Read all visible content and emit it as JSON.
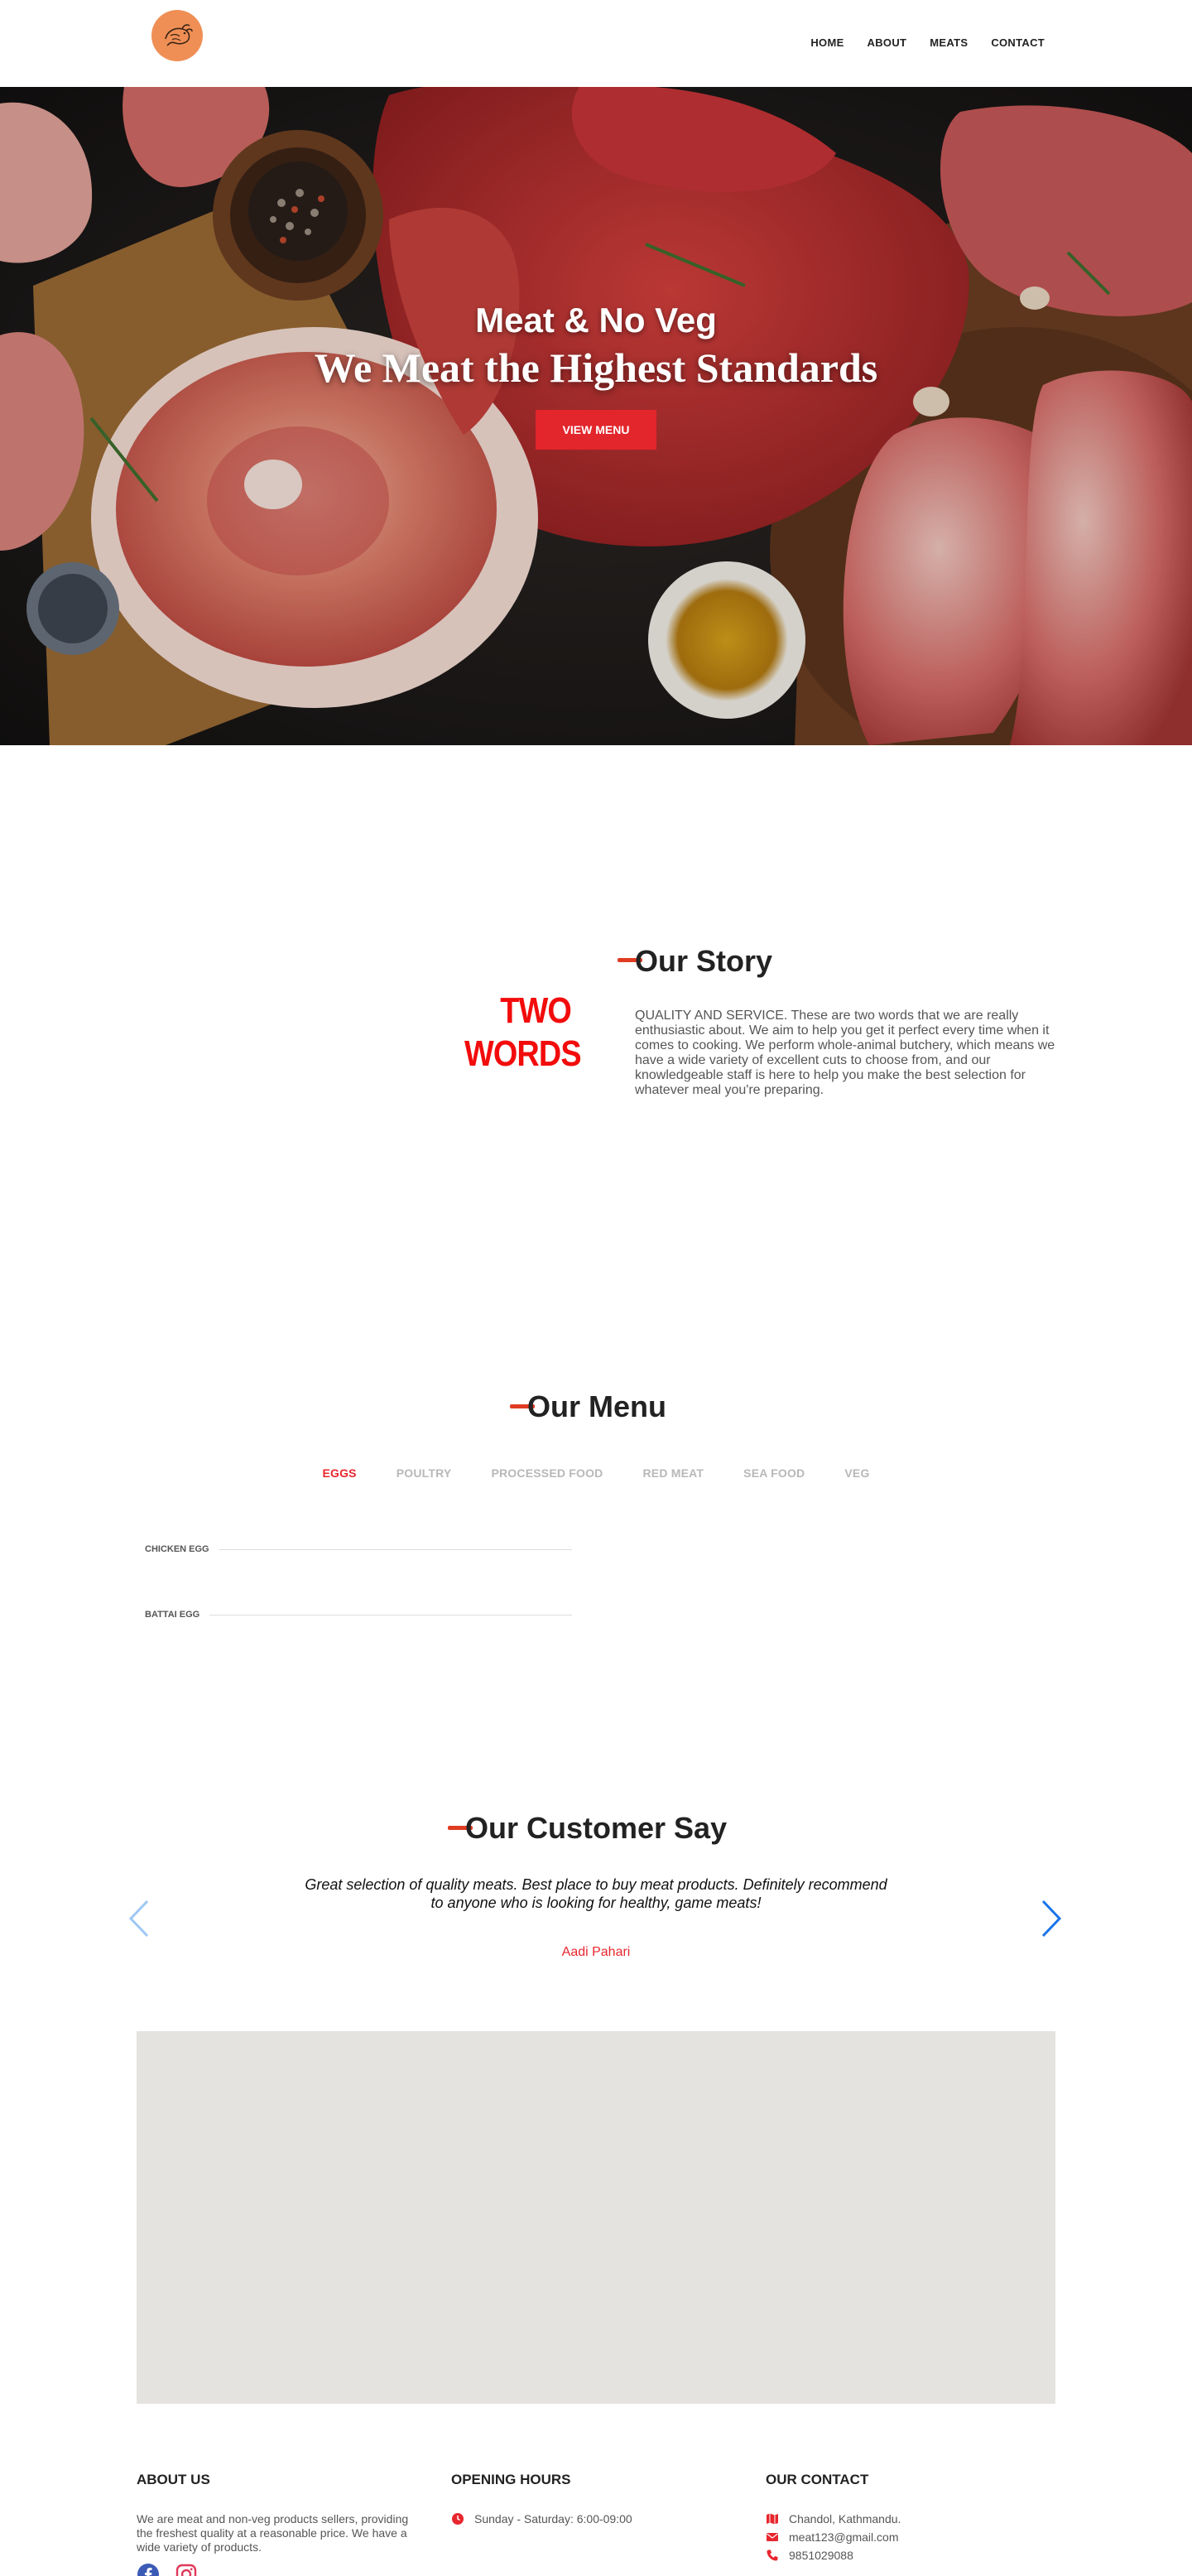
{
  "nav": {
    "items": [
      {
        "label": "HOME"
      },
      {
        "label": "ABOUT"
      },
      {
        "label": "MEATS"
      },
      {
        "label": "CONTACT"
      }
    ]
  },
  "hero": {
    "subtitle": "Meat & No Veg",
    "title": "We Meat the Highest Standards",
    "button_label": "VIEW MENU"
  },
  "story": {
    "highlight": "TWO WORDS",
    "title": "Our Story",
    "text": "QUALITY AND SERVICE. These are two words that we are really enthusiastic about. We aim to help you get it perfect every time when it comes to cooking. We perform whole-animal butchery, which means we have a wide variety of excellent cuts to choose from, and our knowledgeable staff is here to help you make the best selection for whatever meal you're preparing."
  },
  "menu": {
    "title": "Our Menu",
    "tabs": [
      {
        "label": "EGGS",
        "active": true
      },
      {
        "label": "POULTRY",
        "active": false
      },
      {
        "label": "PROCESSED FOOD",
        "active": false
      },
      {
        "label": "RED MEAT",
        "active": false
      },
      {
        "label": "SEA FOOD",
        "active": false
      },
      {
        "label": "VEG",
        "active": false
      }
    ],
    "items": [
      {
        "name": "CHICKEN EGG"
      },
      {
        "name": "BATTAI EGG"
      }
    ]
  },
  "testimonials": {
    "title": "Our Customer Say",
    "quote": "Great selection of quality meats. Best place to buy meat products. Definitely recommend to anyone who is looking for healthy, game meats!",
    "author": "Aadi Pahari"
  },
  "footer": {
    "about": {
      "heading": "ABOUT US",
      "text": "We are meat and non-veg products sellers, providing the freshest quality at a reasonable price. We have a wide variety of products."
    },
    "hours": {
      "heading": "OPENING HOURS",
      "text": "Sunday - Saturday: 6:00-09:00"
    },
    "contact": {
      "heading": "OUR CONTACT",
      "address": "Chandol, Kathmandu.",
      "email": "meat123@gmail.com",
      "phone": "9851029088"
    }
  },
  "colors": {
    "accent": "#e8262e",
    "dash": "#e03c22",
    "logo_bg": "#ef8f55",
    "map_bg": "#e5e3df"
  }
}
